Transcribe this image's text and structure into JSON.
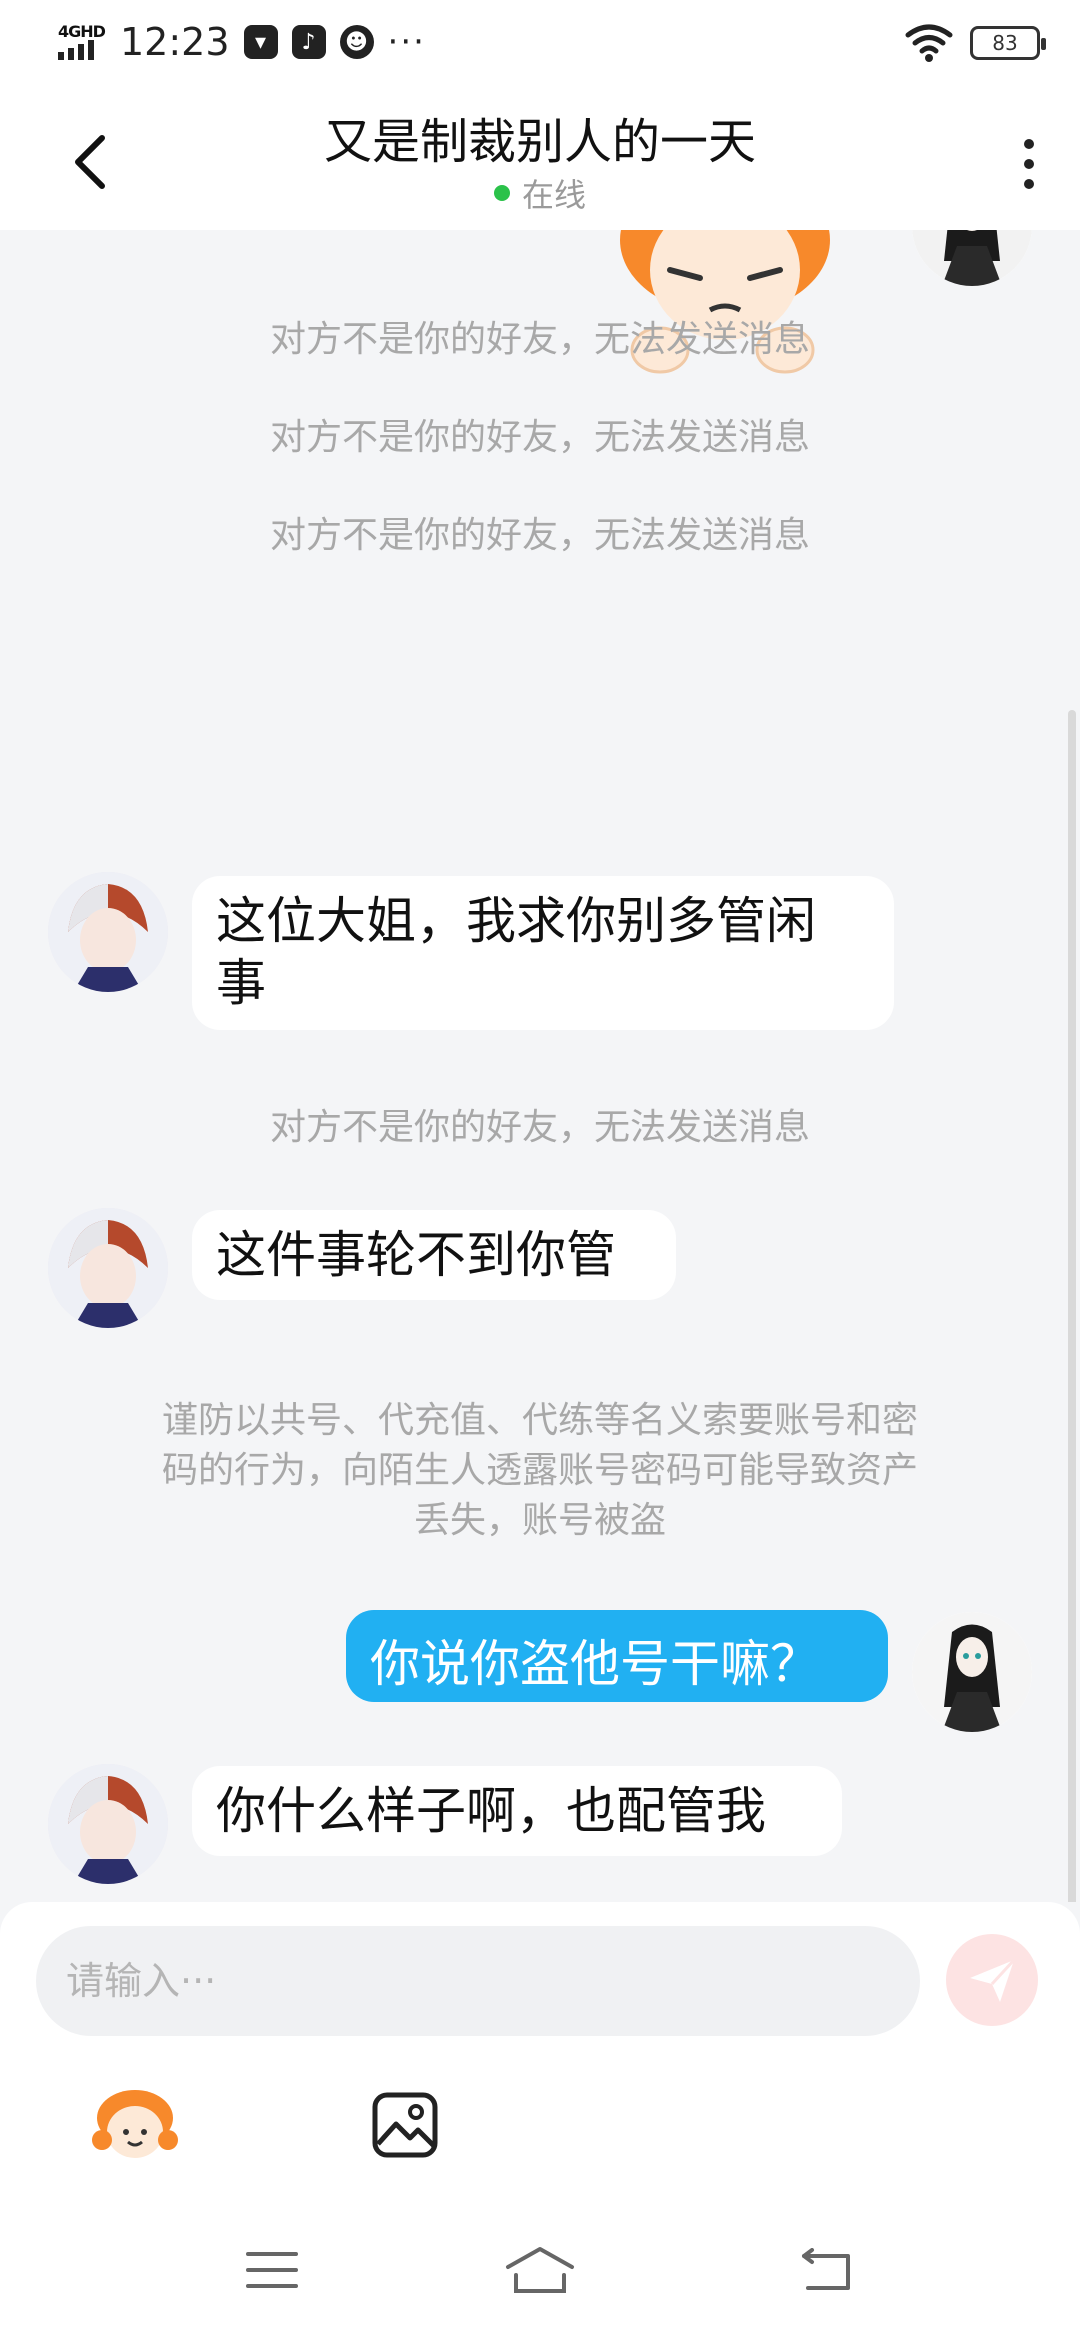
{
  "status_bar": {
    "network": "4GHD",
    "time": "12:23",
    "battery": "83",
    "more": "···"
  },
  "header": {
    "title": "又是制裁别人的一天",
    "presence": "在线"
  },
  "messages": {
    "sys_1": "对方不是你的好友，无法发送消息",
    "sys_2": "对方不是你的好友，无法发送消息",
    "sys_3": "对方不是你的好友，无法发送消息",
    "in_1_line1": "这位大姐，我求你别多管闲",
    "in_1_line2": "事",
    "sys_4": "对方不是你的好友，无法发送消息",
    "in_2": "这件事轮不到你管",
    "warning_line1": "谨防以共号、代充值、代练等名义索要账号和密",
    "warning_line2": "码的行为，向陌生人透露账号密码可能导致资产",
    "warning_line3": "丢失，账号被盗",
    "out_1": "你说你盗他号干嘛？",
    "in_3": "你什么样子啊，也配管我"
  },
  "input": {
    "placeholder": "请输入···"
  },
  "colors": {
    "accent_blue": "#21b0f2",
    "online_green": "#2bc24a",
    "send_disabled": "#fde3e3"
  },
  "icons": {
    "back": "chevron-left-icon",
    "more": "more-vertical-icon",
    "send": "send-icon",
    "emoji": "emoji-icon",
    "image": "image-icon",
    "nav_menu": "menu-icon",
    "nav_home": "home-icon",
    "nav_back": "back-icon"
  }
}
